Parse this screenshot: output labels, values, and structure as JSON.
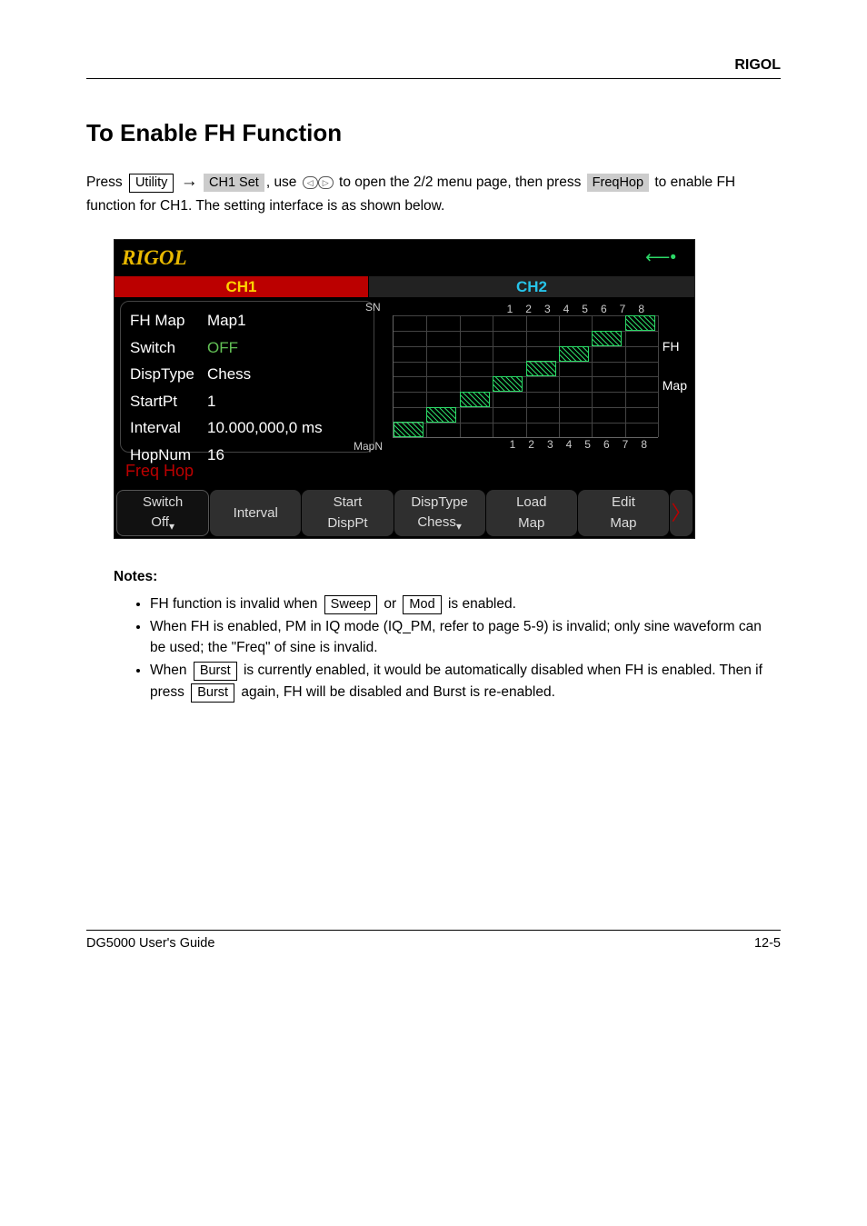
{
  "brand": "RIGOL",
  "title": "To Enable FH Function",
  "para1_a": "Press ",
  "key_utility": "Utility",
  "para1_b": " ",
  "soft_ch1set": "CH1 Set",
  "para1_c": ", use ",
  "para1_d": " to open the 2/2 menu page, then press ",
  "soft_freqhop": "FreqHop",
  "para1_e": " to enable FH function for CH1. The setting interface is as shown below.",
  "arrow": "→",
  "screen": {
    "logo": "RIGOL",
    "ch1": "CH1",
    "ch2": "CH2",
    "params": [
      [
        "FH Map",
        "Map1"
      ],
      [
        "Switch",
        "OFF"
      ],
      [
        "DispType",
        "Chess"
      ],
      [
        "StartPt",
        "1"
      ],
      [
        "Interval",
        "10.000,000,0 ms"
      ],
      [
        "HopNum",
        "16"
      ]
    ],
    "sn_label": "SN",
    "sn_nums": "12345678",
    "mapn_label": "MapN",
    "mapn_nums": "12345678",
    "right_fh": "FH",
    "right_map": "Map",
    "statusline": "Freq Hop",
    "menu": [
      {
        "l1": "Switch",
        "l2": "Off"
      },
      {
        "l1": "Interval",
        "l2": ""
      },
      {
        "l1": "Start",
        "l2": "DispPt"
      },
      {
        "l1": "DispType",
        "l2": "Chess"
      },
      {
        "l1": "Load",
        "l2": "Map"
      },
      {
        "l1": "Edit",
        "l2": "Map"
      }
    ]
  },
  "notes_head": "Notes:",
  "key_sweep": "Sweep",
  "key_mod": "Mod",
  "key_burst": "Burst",
  "note1_a": "FH function is invalid when ",
  "note1_b": " or ",
  "note1_c": " is enabled.",
  "note2": "When FH is enabled, PM in IQ mode (IQ_PM, refer to page 5-9) is invalid; only sine waveform can be used; the \"Freq\" of sine is invalid.",
  "note3_a": "When ",
  "note3_b": " is currently enabled, it would be automatically disabled when FH is enabled. Then if press ",
  "note3_c": " again, FH will be disabled and Burst is re-enabled.",
  "footer_left": "DG5000 User's Guide",
  "footer_right": "12-5",
  "chart_data": {
    "type": "heatmap",
    "title": "FH Map",
    "xlabel": "MapN",
    "ylabel": "SN",
    "x_ticks": [
      1,
      2,
      3,
      4,
      5,
      6,
      7,
      8
    ],
    "y_ticks": [
      1,
      2,
      3,
      4,
      5,
      6,
      7,
      8
    ],
    "xlim": [
      1,
      8
    ],
    "ylim": [
      1,
      8
    ],
    "description": "Diagonal chess map: cell (i,i) filled for i=1..8, origin bottom-left, filled cells shown hatched green",
    "filled_cells": [
      [
        1,
        1
      ],
      [
        2,
        2
      ],
      [
        3,
        3
      ],
      [
        4,
        4
      ],
      [
        5,
        5
      ],
      [
        6,
        6
      ],
      [
        7,
        7
      ],
      [
        8,
        8
      ]
    ]
  }
}
